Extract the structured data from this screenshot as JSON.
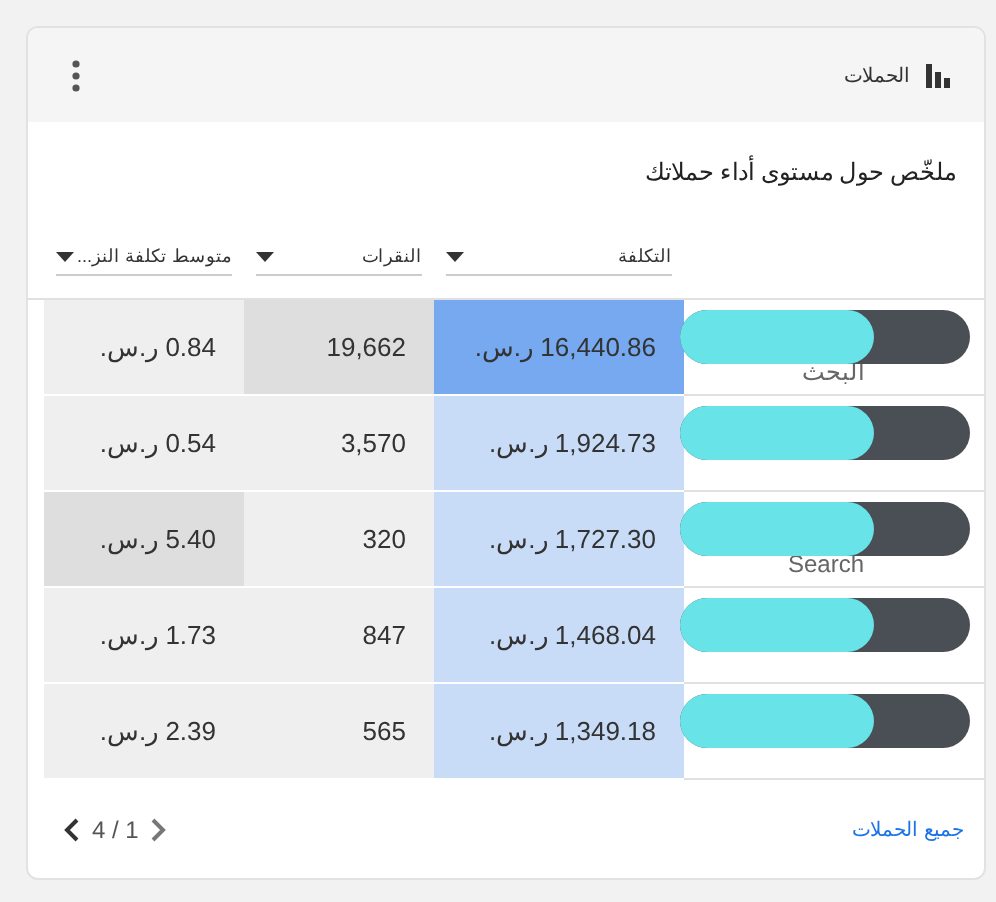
{
  "card": {
    "title": "الحملات",
    "subtitle": "ملخّص حول مستوى أداء حملاتك"
  },
  "table": {
    "columns": [
      {
        "label": "التكلفة",
        "kind": "sorted"
      },
      {
        "label": "النقرات",
        "kind": "plain"
      },
      {
        "label": "متوسط تكلفة النز...",
        "kind": "plain"
      }
    ],
    "rows": [
      {
        "name": "البحث",
        "cells": [
          {
            "text": "16,440.86 ر.س.",
            "strong": true
          },
          {
            "text": "19,662",
            "strong": true
          },
          {
            "text": "0.84 ر.س.",
            "strong": false
          }
        ]
      },
      {
        "cells": [
          {
            "text": "1,924.73 ر.س.",
            "strong": false
          },
          {
            "text": "3,570",
            "strong": false
          },
          {
            "text": "0.54 ر.س.",
            "strong": false
          }
        ]
      },
      {
        "name": "Search",
        "cells": [
          {
            "text": "1,727.30 ر.س.",
            "strong": false
          },
          {
            "text": "320",
            "strong": false
          },
          {
            "text": "5.40 ر.س.",
            "strong": true
          }
        ]
      },
      {
        "cells": [
          {
            "text": "1,468.04 ر.س.",
            "strong": false
          },
          {
            "text": "847",
            "strong": false
          },
          {
            "text": "1.73 ر.س.",
            "strong": false
          }
        ]
      },
      {
        "cells": [
          {
            "text": "1,349.18 ر.س.",
            "strong": false
          },
          {
            "text": "565",
            "strong": false
          },
          {
            "text": "2.39 ر.س.",
            "strong": false
          }
        ]
      }
    ]
  },
  "footer": {
    "link": "جميع الحملات",
    "pager": "4 / 1"
  }
}
